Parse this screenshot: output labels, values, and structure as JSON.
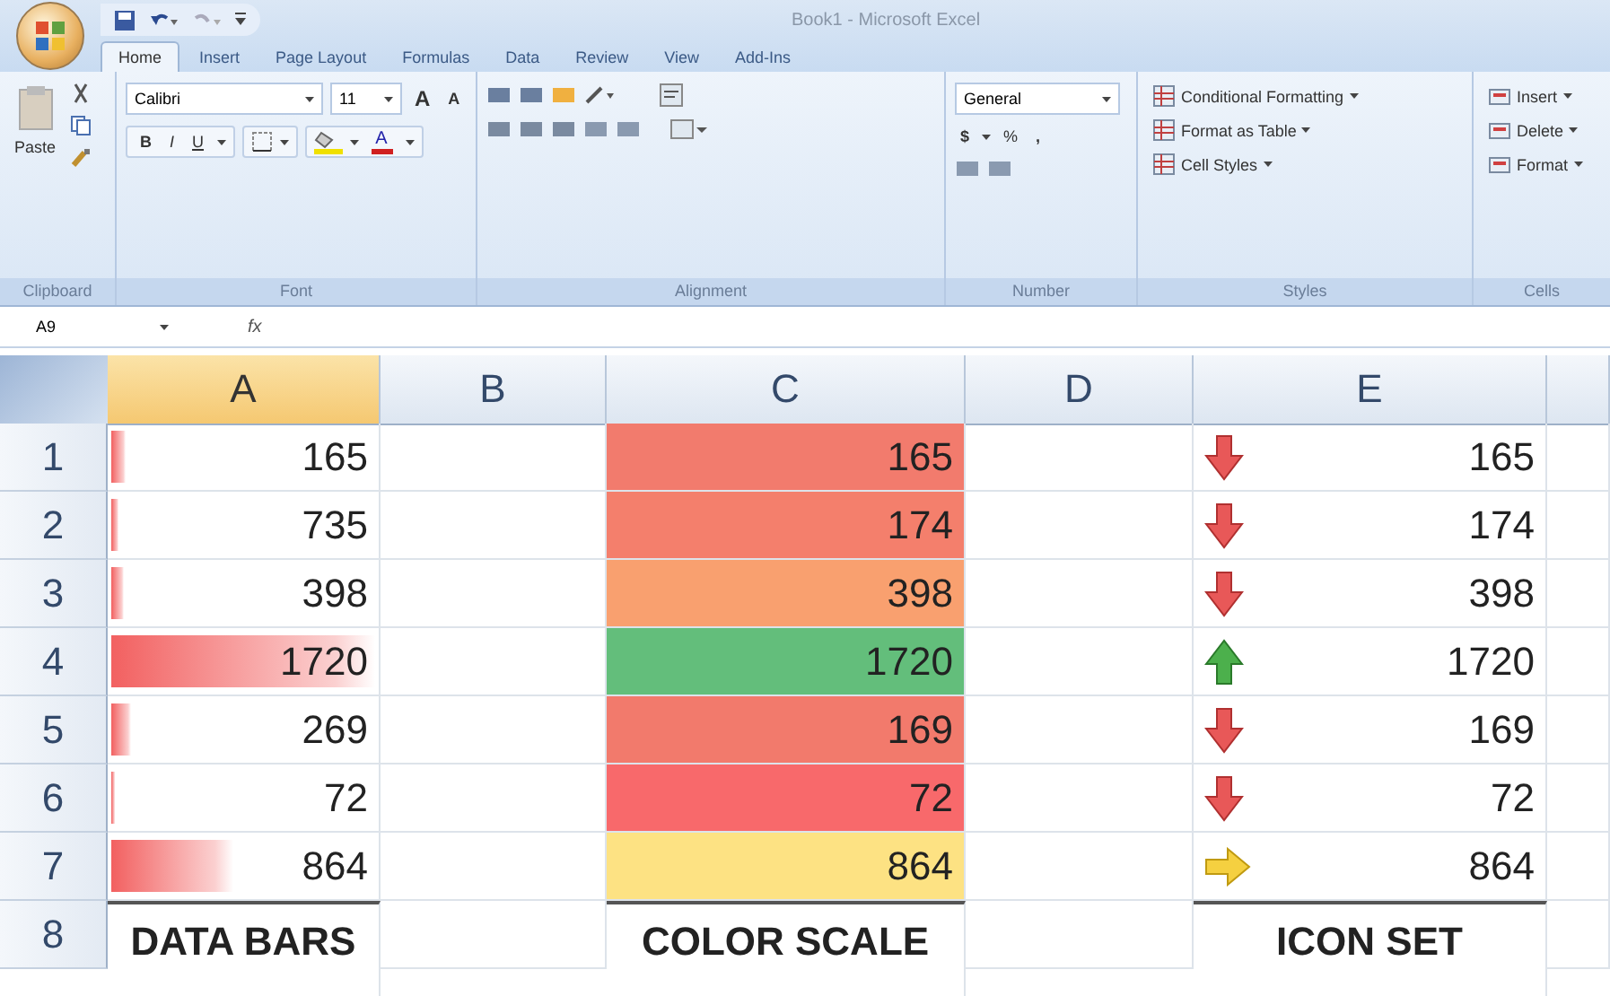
{
  "window": {
    "title": "Book1 - Microsoft Excel"
  },
  "tabs": [
    {
      "label": "Home",
      "selected": true
    },
    {
      "label": "Insert",
      "selected": false
    },
    {
      "label": "Page Layout",
      "selected": false
    },
    {
      "label": "Formulas",
      "selected": false
    },
    {
      "label": "Data",
      "selected": false
    },
    {
      "label": "Review",
      "selected": false
    },
    {
      "label": "View",
      "selected": false
    },
    {
      "label": "Add-Ins",
      "selected": false
    }
  ],
  "ribbon": {
    "clipboard": {
      "paste": "Paste",
      "label": "Clipboard"
    },
    "font": {
      "family": "Calibri",
      "size": "11",
      "grow": "A",
      "shrink": "A",
      "bold": "B",
      "italic": "I",
      "underline": "U",
      "color_button": "A",
      "label": "Font"
    },
    "alignment": {
      "label": "Alignment"
    },
    "number": {
      "format": "General",
      "currency": "$",
      "percent": "%",
      "comma": ",",
      "label": "Number"
    },
    "styles": {
      "items": [
        "Conditional Formatting",
        "Format as Table",
        "Cell Styles"
      ],
      "label": "Styles"
    },
    "cells": {
      "items": [
        "Insert",
        "Delete",
        "Format"
      ],
      "label": "Cells"
    }
  },
  "formula_bar": {
    "name_box": "A9",
    "fx": "fx"
  },
  "sheet": {
    "columns": [
      {
        "label": "A",
        "selected": true
      },
      {
        "label": "B",
        "selected": false
      },
      {
        "label": "C",
        "selected": false
      },
      {
        "label": "D",
        "selected": false
      },
      {
        "label": "E",
        "selected": false
      }
    ],
    "rows": [
      {
        "number": "1",
        "a": "165",
        "level": 0.08,
        "c": "165",
        "color": "#f27b6d",
        "e": "165",
        "kind": "down"
      },
      {
        "number": "2",
        "a": "735",
        "level": 0.05,
        "c": "174",
        "color": "#f47f6c",
        "e": "174",
        "kind": "down"
      },
      {
        "number": "3",
        "a": "398",
        "level": 0.07,
        "c": "398",
        "color": "#f9a06f",
        "e": "398",
        "kind": "down"
      },
      {
        "number": "4",
        "a": "1720",
        "level": 1.0,
        "c": "1720",
        "color": "#63be7b",
        "e": "1720",
        "kind": "up"
      },
      {
        "number": "5",
        "a": "269",
        "level": 0.1,
        "c": "169",
        "color": "#f27a6c",
        "e": "169",
        "kind": "down"
      },
      {
        "number": "6",
        "a": "72",
        "level": 0.04,
        "c": "72",
        "color": "#f8696b",
        "e": "72",
        "kind": "down"
      },
      {
        "number": "7",
        "a": "864",
        "level": 0.48,
        "c": "864",
        "color": "#fde283",
        "e": "864",
        "kind": "right"
      }
    ],
    "footer_row": {
      "number": "8",
      "a": "DATA BARS",
      "c": "COLOR SCALE",
      "e": "ICON SET"
    }
  }
}
